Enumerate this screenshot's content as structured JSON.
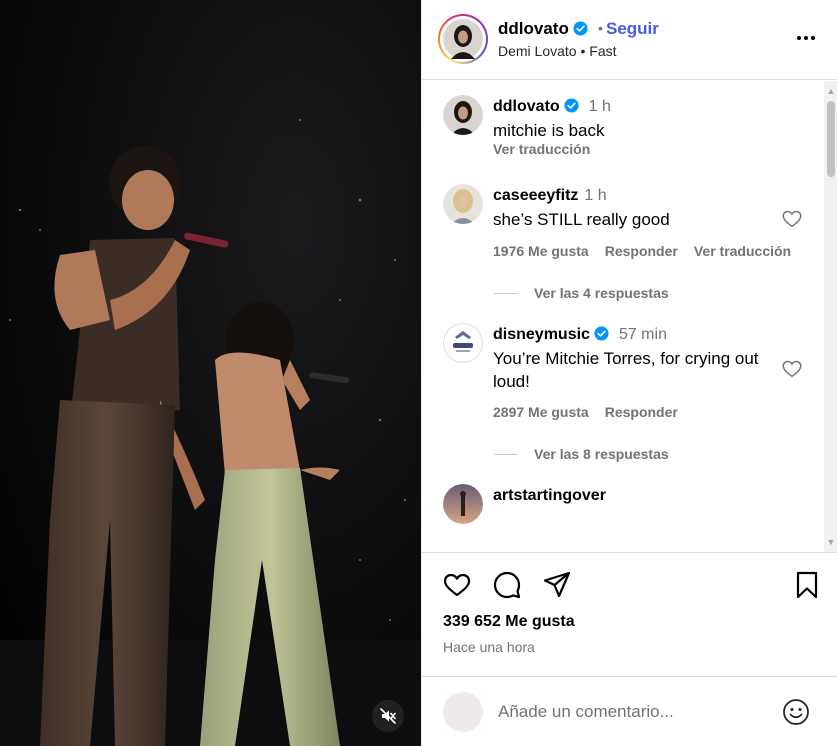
{
  "post": {
    "username": "ddlovato",
    "dot": "•",
    "follow_label": "Seguir",
    "subtitle": "Demi Lovato • Fast",
    "caption_user": "ddlovato",
    "caption_time": "1 h",
    "caption_text": "mitchie is back",
    "caption_translate": "Ver traducción"
  },
  "comments": [
    {
      "username": "caseeeyfitz",
      "time": "1 h",
      "text": "she’s STILL really good",
      "likes": "1976 Me gusta",
      "reply": "Responder",
      "translate": "Ver traducción",
      "replies": "Ver las 4 respuestas"
    },
    {
      "username": "disneymusic",
      "time": "57 min",
      "text_line1": "You’re Mitchie Torres, for crying out",
      "text_line2": "loud!",
      "likes": "2897 Me gusta",
      "reply": "Responder",
      "replies": "Ver las 8 respuestas"
    },
    {
      "username": "artstartingover"
    }
  ],
  "footer": {
    "likes": "339 652 Me gusta",
    "time_ago": "Hace una hora",
    "comment_placeholder": "Añade un comentario..."
  },
  "icons": {
    "verified": "verified-badge-icon",
    "more": "more-horizontal-icon",
    "like": "heart-icon",
    "comment": "comment-bubble-icon",
    "share": "paper-plane-icon",
    "save": "bookmark-icon",
    "emoji": "smiley-icon",
    "mute": "speaker-muted-icon"
  },
  "colors": {
    "follow": "#4a5be0",
    "verified": "#0095f6",
    "muted_text": "#737373"
  }
}
